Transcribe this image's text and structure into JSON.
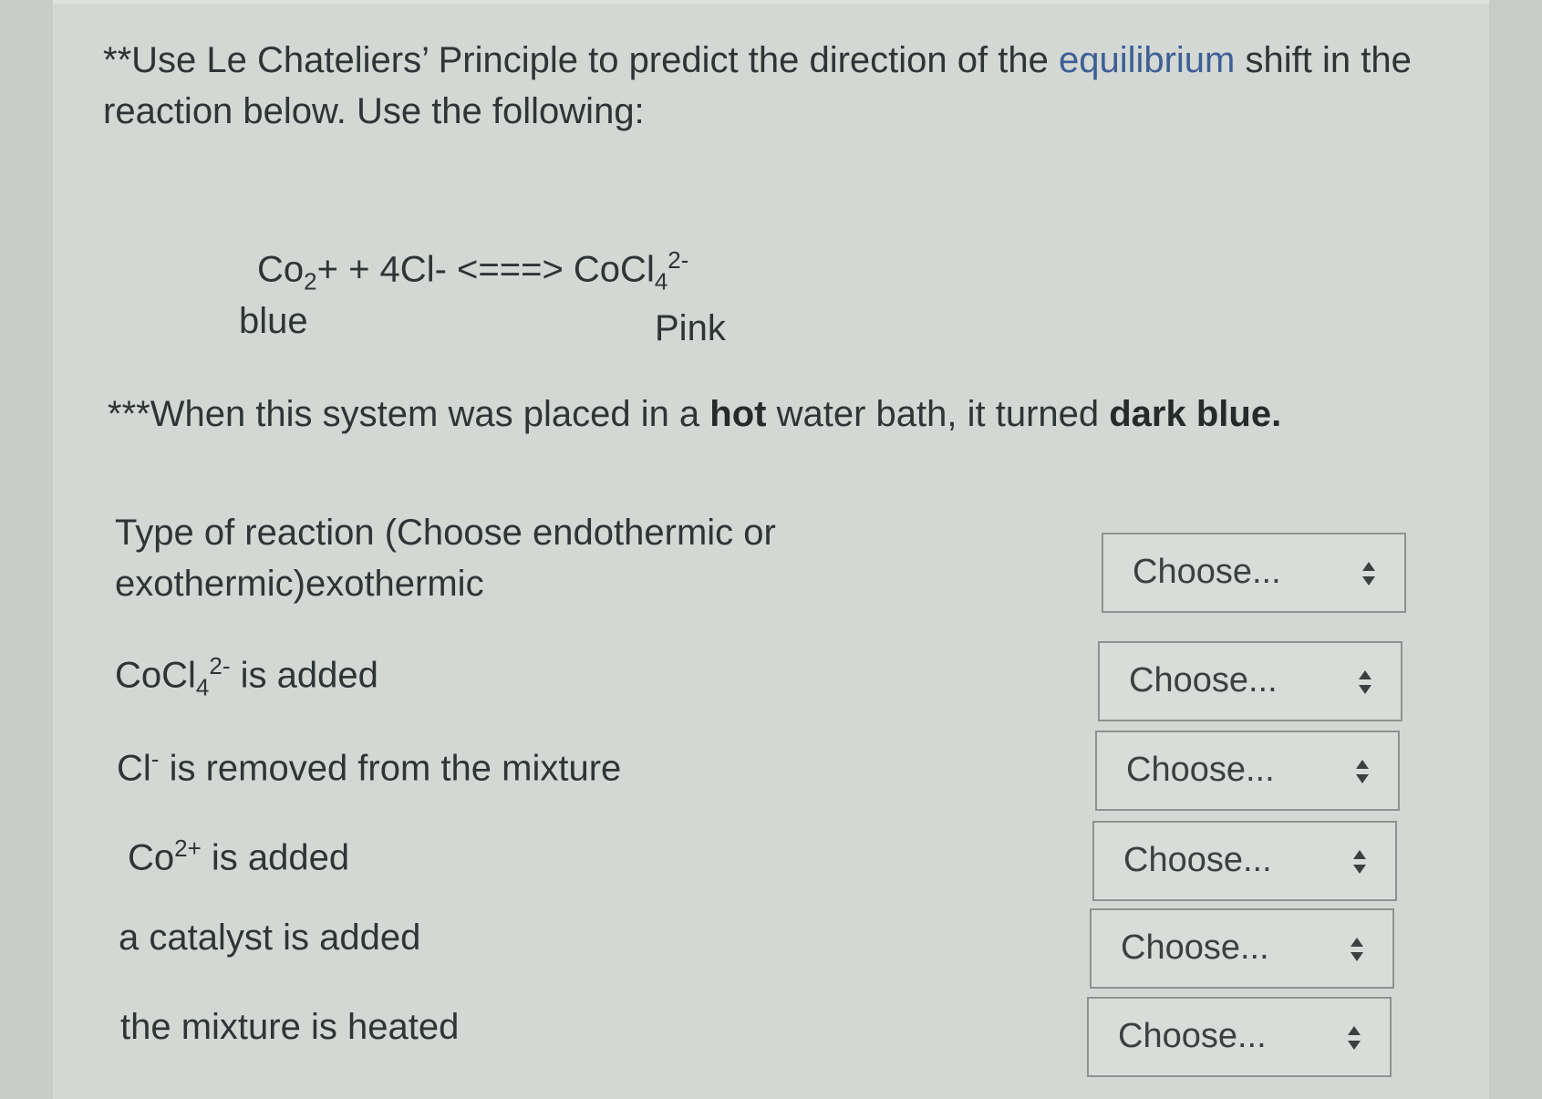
{
  "intro": {
    "prefix": "**Use Le Chateliers’ Principle to predict the direction of the ",
    "link": "equilibrium",
    "suffix": " shift in the reaction below. Use the following:"
  },
  "equation": {
    "reactant": "Co",
    "reactant_sub": "2",
    "reactant_tail": "+  + 4Cl- <===> CoCl",
    "product_sub": "4",
    "product_sup": "2-"
  },
  "labels": {
    "left": "blue",
    "right": "Pink"
  },
  "note": {
    "part1": "***When this system was placed in a ",
    "bold1": "hot",
    "part2": " water bath, it turned ",
    "bold2": "dark blue."
  },
  "questions": [
    {
      "text": "Type of reaction (Choose endothermic or exothermic)exothermic",
      "select": "Choose..."
    },
    {
      "text_main": "CoCl",
      "text_sub": "4",
      "text_sup": "2-",
      "text_tail": " is added",
      "select": "Choose..."
    },
    {
      "text_main": "Cl",
      "text_sup": "-",
      "text_tail": " is removed from the mixture",
      "select": "Choose..."
    },
    {
      "text_main": "Co",
      "text_sup": "2+",
      "text_tail": " is added",
      "select": "Choose..."
    },
    {
      "text": "a catalyst is added",
      "select": "Choose..."
    },
    {
      "text": "the mixture is heated",
      "select": "Choose..."
    }
  ]
}
